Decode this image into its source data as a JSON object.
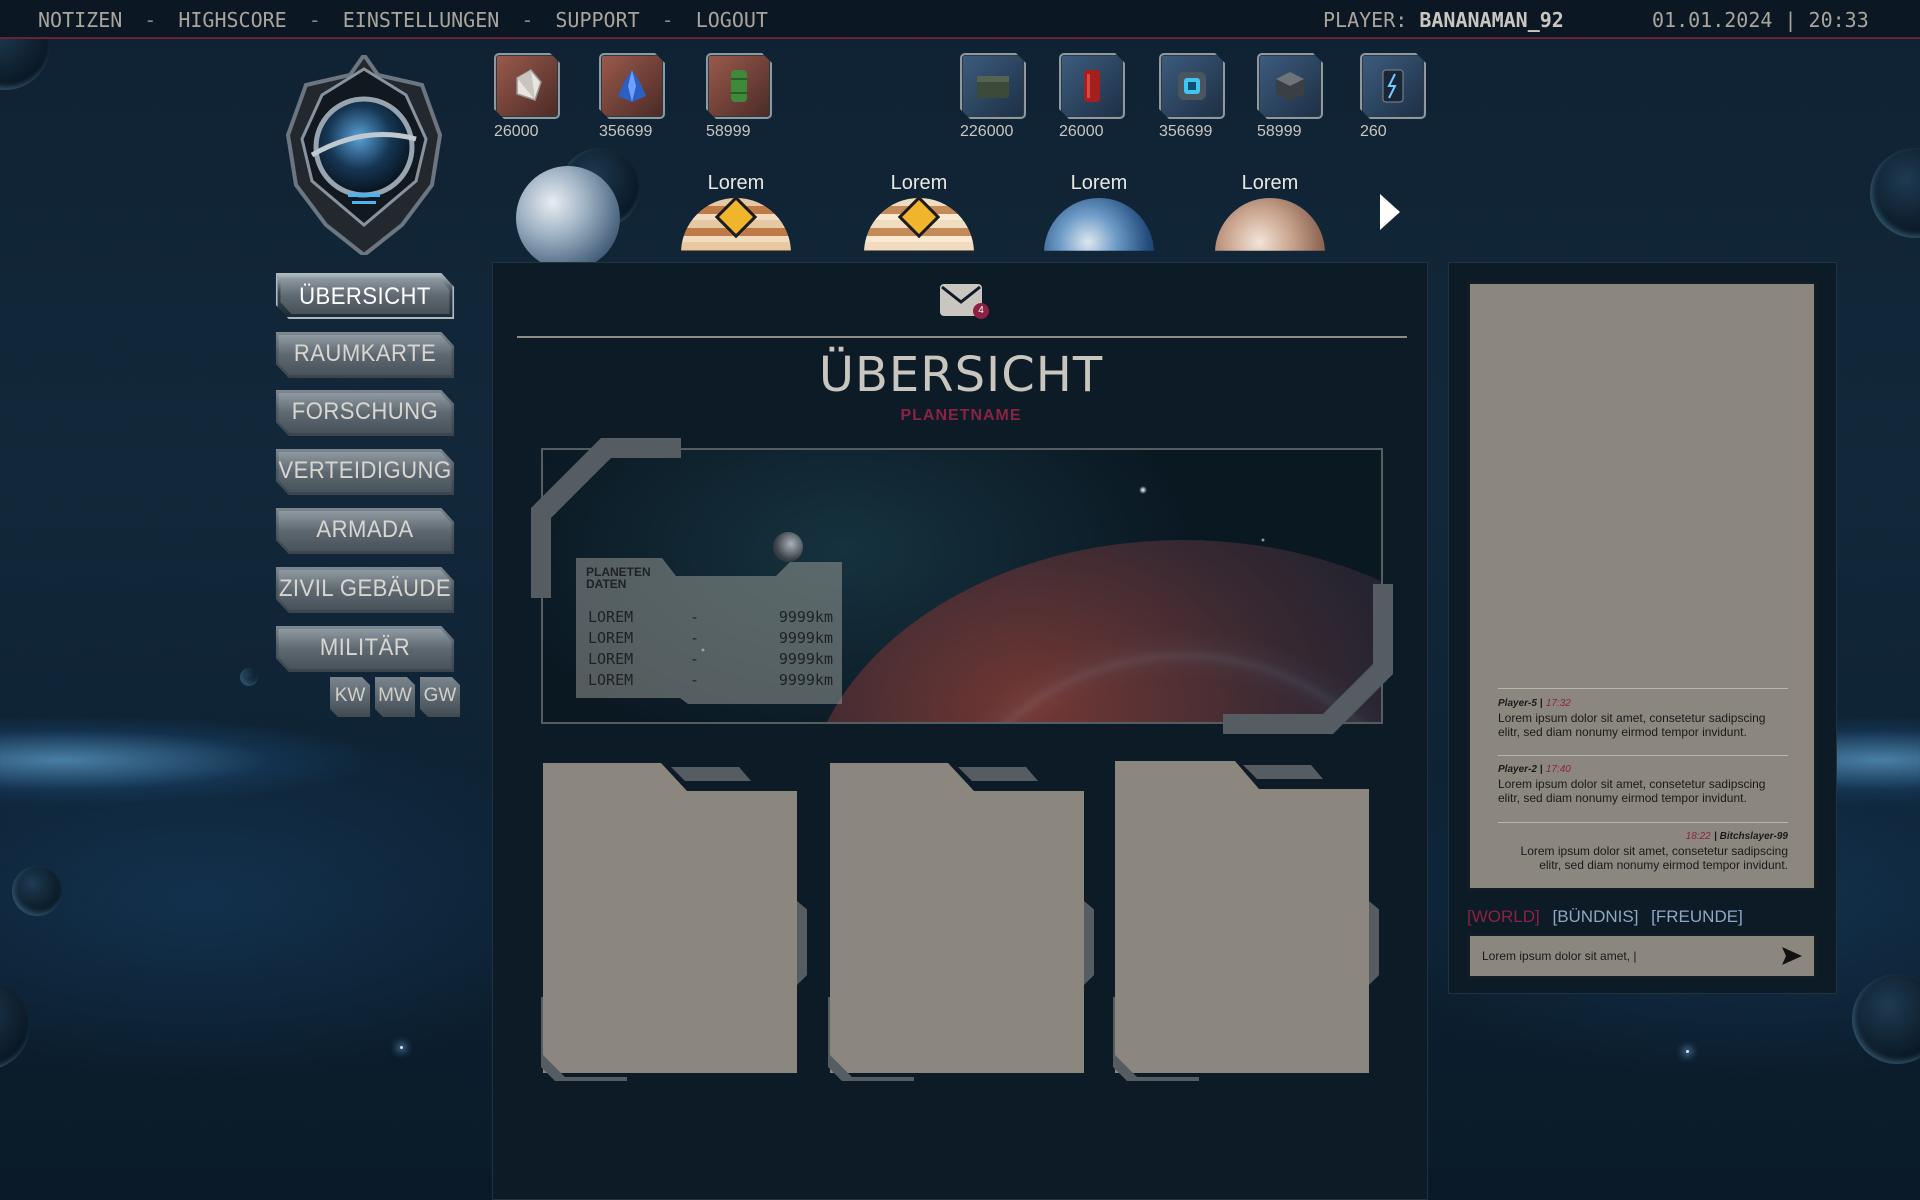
{
  "topbar": {
    "nav": [
      "NOTIZEN",
      "HIGHSCORE",
      "EINSTELLUNGEN",
      "SUPPORT",
      "LOGOUT"
    ],
    "separator": "-",
    "player_label": "PLAYER:",
    "player_name": "BANANAMAN_92",
    "datetime": "01.01.2024 | 20:33"
  },
  "resources": [
    {
      "icon": "crystal-icon",
      "value": "26000"
    },
    {
      "icon": "blue-crystal-icon",
      "value": "356699"
    },
    {
      "icon": "green-barrel-icon",
      "value": "58999"
    },
    {
      "icon": "ammo-box-icon",
      "value": "226000"
    },
    {
      "icon": "red-canister-icon",
      "value": "26000"
    },
    {
      "icon": "energy-core-icon",
      "value": "356699"
    },
    {
      "icon": "metal-cube-icon",
      "value": "58999"
    },
    {
      "icon": "lightning-cell-icon",
      "value": "260"
    }
  ],
  "planets": [
    {
      "label": ""
    },
    {
      "label": "Lorem"
    },
    {
      "label": "Lorem"
    },
    {
      "label": "Lorem"
    },
    {
      "label": "Lorem"
    }
  ],
  "sidebar": {
    "items": [
      {
        "label": "ÜBERSICHT",
        "active": true
      },
      {
        "label": "RAUMKARTE"
      },
      {
        "label": "FORSCHUNG"
      },
      {
        "label": "VERTEIDIGUNG"
      },
      {
        "label": "ARMADA"
      },
      {
        "label": "ZIVIL GEBÄUDE"
      },
      {
        "label": "MILITÄR GEBÄUDE"
      }
    ],
    "size_buttons": [
      "KW",
      "MW",
      "GW"
    ]
  },
  "main": {
    "mail_count": "4",
    "title": "ÜBERSICHT",
    "planet_name": "PLANETNAME",
    "planet_data": {
      "title_line1": "PLANETEN",
      "title_line2": "DATEN",
      "rows": [
        {
          "label": "LOREM",
          "sep": "-",
          "value": "9999km"
        },
        {
          "label": "LOREM",
          "sep": "-",
          "value": "9999km"
        },
        {
          "label": "LOREM",
          "sep": "-",
          "value": "9999km"
        },
        {
          "label": "LOREM",
          "sep": "-",
          "value": "9999km"
        }
      ]
    }
  },
  "chat": {
    "messages": [
      {
        "player": "Player-5 |",
        "time": "17:32",
        "text": "Lorem ipsum dolor sit amet, consetetur sadipscing elitr, sed diam nonumy eirmod tempor invidunt."
      },
      {
        "player": "Player-2 |",
        "time": "17:40",
        "text": "Lorem ipsum dolor sit amet, consetetur sadipscing elitr, sed diam nonumy eirmod tempor invidunt."
      },
      {
        "player": "| Bitchslayer-99",
        "time": "18:22",
        "text": "Lorem ipsum dolor sit amet, consetetur sadipscing elitr, sed diam nonumy eirmod tempor invidunt."
      }
    ],
    "tabs": [
      "[WORLD]",
      "[BÜNDNIS]",
      "[FREUNDE]"
    ],
    "input_value": "Lorem ipsum dolor sit amet, |"
  },
  "colors": {
    "accent": "#8b2244",
    "panel": "#0d1b26",
    "paper": "#8c877e"
  }
}
